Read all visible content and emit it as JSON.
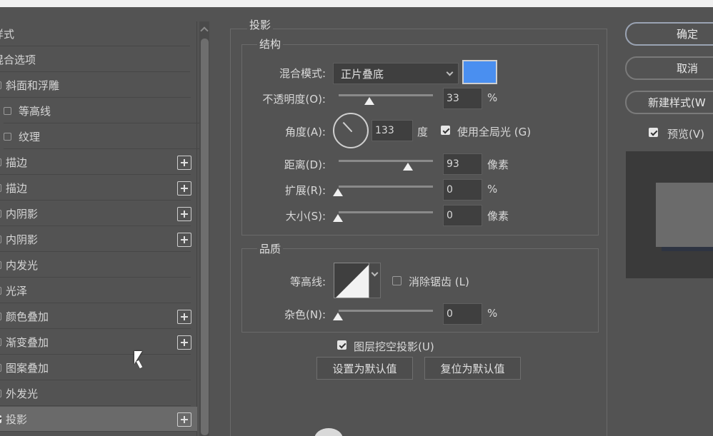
{
  "styles_panel": {
    "header": "样式",
    "blend_options": "混合选项",
    "items": [
      {
        "label": "斜面和浮雕",
        "checked": false,
        "indent": false,
        "plus": false
      },
      {
        "label": "等高线",
        "checked": false,
        "indent": true,
        "plus": false
      },
      {
        "label": "纹理",
        "checked": false,
        "indent": true,
        "plus": false
      },
      {
        "label": "描边",
        "checked": false,
        "indent": false,
        "plus": true
      },
      {
        "label": "描边",
        "checked": false,
        "indent": false,
        "plus": true
      },
      {
        "label": "内阴影",
        "checked": false,
        "indent": false,
        "plus": true
      },
      {
        "label": "内阴影",
        "checked": false,
        "indent": false,
        "plus": true
      },
      {
        "label": "内发光",
        "checked": false,
        "indent": false,
        "plus": false
      },
      {
        "label": "光泽",
        "checked": false,
        "indent": false,
        "plus": false
      },
      {
        "label": "颜色叠加",
        "checked": false,
        "indent": false,
        "plus": true
      },
      {
        "label": "渐变叠加",
        "checked": false,
        "indent": false,
        "plus": true
      },
      {
        "label": "图案叠加",
        "checked": false,
        "indent": false,
        "plus": false
      },
      {
        "label": "外发光",
        "checked": false,
        "indent": false,
        "plus": false
      },
      {
        "label": "投影",
        "checked": true,
        "indent": false,
        "plus": true,
        "selected": true
      }
    ]
  },
  "drop_shadow": {
    "title": "投影",
    "structure": {
      "title": "结构",
      "blend_mode_label": "混合模式:",
      "blend_mode_value": "正片叠底",
      "shadow_color": "#4a8ff0",
      "opacity_label": "不透明度(O):",
      "opacity_value": "33",
      "opacity_unit": "%",
      "angle_label": "角度(A):",
      "angle_value": "133",
      "angle_unit": "度",
      "global_light_label": "使用全局光 (G)",
      "global_light_checked": true,
      "distance_label": "距离(D):",
      "distance_value": "93",
      "distance_unit": "像素",
      "spread_label": "扩展(R):",
      "spread_value": "0",
      "spread_unit": "%",
      "size_label": "大小(S):",
      "size_value": "0",
      "size_unit": "像素"
    },
    "quality": {
      "title": "品质",
      "contour_label": "等高线:",
      "antialias_label": "消除锯齿 (L)",
      "antialias_checked": false,
      "noise_label": "杂色(N):",
      "noise_value": "0",
      "noise_unit": "%"
    },
    "knockout_label": "图层挖空投影(U)",
    "knockout_checked": true,
    "set_default_label": "设置为默认值",
    "reset_default_label": "复位为默认值"
  },
  "actions": {
    "ok_label": "确定",
    "cancel_label": "取消",
    "new_style_label": "新建样式(W",
    "preview_label": "预览(V)",
    "preview_checked": true
  }
}
